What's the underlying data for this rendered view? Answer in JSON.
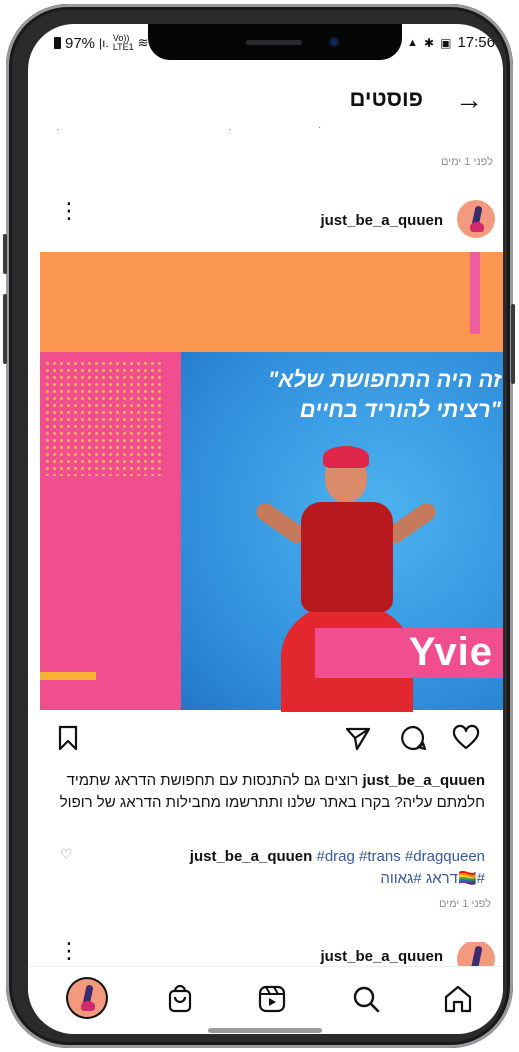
{
  "status": {
    "battery": "97%",
    "volte": "Vo))",
    "lte": "LTE1",
    "time": "17:56"
  },
  "header": {
    "title": "פוסטים"
  },
  "prev_post": {
    "timeago": "לפני 1 ימים"
  },
  "post": {
    "username": "just_be_a_quuen",
    "image": {
      "quote_line1": "זה היה התחפושת שלא\"",
      "quote_line2": "\"רציתי להוריד בחיים",
      "name": "Yvie"
    },
    "caption_user": "just_be_a_quuen",
    "caption_text": " רוצים גם להתנסות עם תחפושת הדראג שתמיד חלמתם עליה? בקרו באתר שלנו ותתרשמו מחבילות הדראג של רופול",
    "comment_user": "just_be_a_quuen",
    "tags": [
      "#dragqueen",
      "#trans",
      "#drag"
    ],
    "tags_line2": "#🏳️‍🌈דראג #גאווה",
    "timeago": "לפני 1 ימים"
  },
  "next_post": {
    "username": "just_be_a_quuen"
  },
  "colors": {
    "orange": "#fa9650",
    "pink": "#f04e8f",
    "blue": "#2f8ddb",
    "yellow": "#f9c349",
    "tag_link": "#385898"
  }
}
